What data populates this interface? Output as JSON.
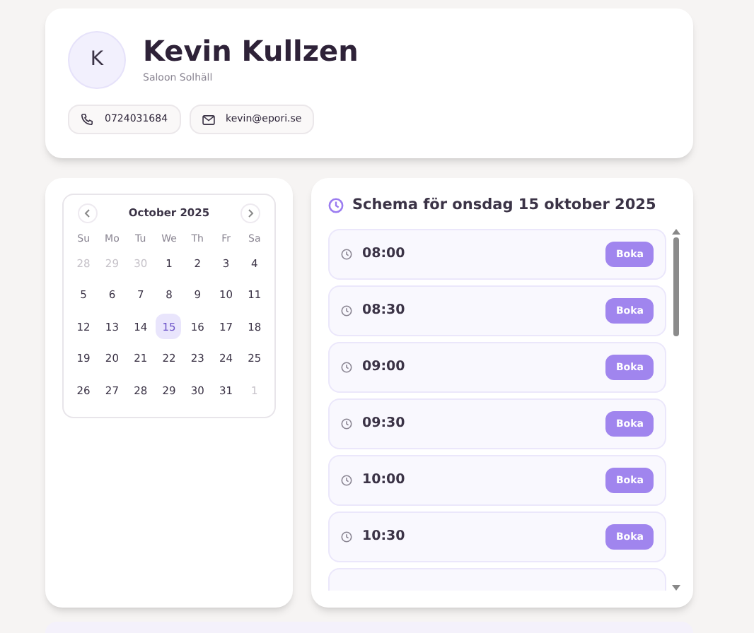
{
  "profile": {
    "initial": "K",
    "name": "Kevin Kullzen",
    "subtitle": "Saloon Solhäll",
    "contacts": [
      {
        "kind": "phone",
        "text": "0724031684"
      },
      {
        "kind": "email",
        "text": "kevin@epori.se"
      }
    ]
  },
  "calendar": {
    "month": "October 2025",
    "weekdays": [
      "Su",
      "Mo",
      "Tu",
      "We",
      "Th",
      "Fr",
      "Sa"
    ],
    "days": [
      {
        "label": "28",
        "outside": true,
        "selected": false
      },
      {
        "label": "29",
        "outside": true,
        "selected": false
      },
      {
        "label": "30",
        "outside": true,
        "selected": false
      },
      {
        "label": "1",
        "outside": false,
        "selected": false
      },
      {
        "label": "2",
        "outside": false,
        "selected": false
      },
      {
        "label": "3",
        "outside": false,
        "selected": false
      },
      {
        "label": "4",
        "outside": false,
        "selected": false
      },
      {
        "label": "5",
        "outside": false,
        "selected": false
      },
      {
        "label": "6",
        "outside": false,
        "selected": false
      },
      {
        "label": "7",
        "outside": false,
        "selected": false
      },
      {
        "label": "8",
        "outside": false,
        "selected": false
      },
      {
        "label": "9",
        "outside": false,
        "selected": false
      },
      {
        "label": "10",
        "outside": false,
        "selected": false
      },
      {
        "label": "11",
        "outside": false,
        "selected": false
      },
      {
        "label": "12",
        "outside": false,
        "selected": false
      },
      {
        "label": "13",
        "outside": false,
        "selected": false
      },
      {
        "label": "14",
        "outside": false,
        "selected": false
      },
      {
        "label": "15",
        "outside": false,
        "selected": true
      },
      {
        "label": "16",
        "outside": false,
        "selected": false
      },
      {
        "label": "17",
        "outside": false,
        "selected": false
      },
      {
        "label": "18",
        "outside": false,
        "selected": false
      },
      {
        "label": "19",
        "outside": false,
        "selected": false
      },
      {
        "label": "20",
        "outside": false,
        "selected": false
      },
      {
        "label": "21",
        "outside": false,
        "selected": false
      },
      {
        "label": "22",
        "outside": false,
        "selected": false
      },
      {
        "label": "23",
        "outside": false,
        "selected": false
      },
      {
        "label": "24",
        "outside": false,
        "selected": false
      },
      {
        "label": "25",
        "outside": false,
        "selected": false
      },
      {
        "label": "26",
        "outside": false,
        "selected": false
      },
      {
        "label": "27",
        "outside": false,
        "selected": false
      },
      {
        "label": "28",
        "outside": false,
        "selected": false
      },
      {
        "label": "29",
        "outside": false,
        "selected": false
      },
      {
        "label": "30",
        "outside": false,
        "selected": false
      },
      {
        "label": "31",
        "outside": false,
        "selected": false
      },
      {
        "label": "1",
        "outside": true,
        "selected": false
      }
    ]
  },
  "schedule": {
    "title": "Schema för onsdag 15 oktober 2025",
    "slots": [
      {
        "time": "08:00",
        "button": "Boka"
      },
      {
        "time": "08:30",
        "button": "Boka"
      },
      {
        "time": "09:00",
        "button": "Boka"
      },
      {
        "time": "09:30",
        "button": "Boka"
      },
      {
        "time": "10:00",
        "button": "Boka"
      },
      {
        "time": "10:30",
        "button": "Boka"
      }
    ]
  }
}
